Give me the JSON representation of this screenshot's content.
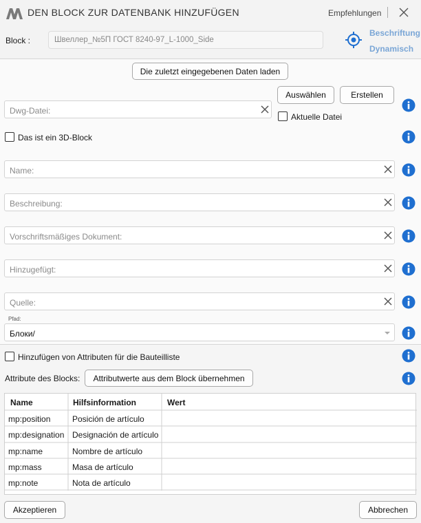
{
  "window": {
    "title": "DEN BLOCK ZUR DATENBANK HINZUFÜGEN",
    "recommendations": "Empfehlungen"
  },
  "block": {
    "label": "Block :",
    "value": "Швеллер_№5П ГОСТ 8240-97_L-1000_Side",
    "beschriftung": "Beschriftung",
    "dynamisch": "Dynamisch"
  },
  "actions": {
    "load_last": "Die zuletzt eingegebenen Daten laden",
    "select": "Auswählen",
    "create": "Erstellen"
  },
  "dwg": {
    "placeholder": "Dwg-Datei:",
    "current_file_label": "Aktuelle Datei"
  },
  "is3d": {
    "label": "Das ist ein 3D-Block"
  },
  "fields": {
    "name": "Name:",
    "description": "Beschreibung:",
    "regulatory_doc": "Vorschriftsmäßiges Dokument:",
    "added": "Hinzugefügt:",
    "source": "Quelle:"
  },
  "path": {
    "label": "Pfad:",
    "value": "Блоки/"
  },
  "attributes": {
    "add_label": "Hinzufügen von Attributen für die Bauteilliste",
    "block_attrs_label": "Attribute des Blocks:",
    "take_button": "Attributwerte aus dem Block übernehmen"
  },
  "table": {
    "headers": [
      "Name",
      "Hilfsinformation",
      "Wert"
    ],
    "rows": [
      {
        "name": "mp:position",
        "info": "Posición de artículo",
        "value": ""
      },
      {
        "name": "mp:designation",
        "info": "Designación de artículo",
        "value": ""
      },
      {
        "name": "mp:name",
        "info": "Nombre de artículo",
        "value": ""
      },
      {
        "name": "mp:mass",
        "info": "Masa de artículo",
        "value": ""
      },
      {
        "name": "mp:note",
        "info": "Nota de artículo",
        "value": ""
      }
    ]
  },
  "footer": {
    "accept": "Akzeptieren",
    "cancel": "Abbrechen"
  },
  "colors": {
    "accent": "#1f6fd0",
    "accent_light": "#7aa6d6",
    "logo": "#7a7a7a"
  },
  "icons": {
    "logo": "app-logo-icon",
    "close": "close-icon",
    "target": "crosshair-target-icon",
    "clear": "clear-x-icon",
    "info": "info-icon",
    "dropdown": "chevron-down-icon"
  }
}
